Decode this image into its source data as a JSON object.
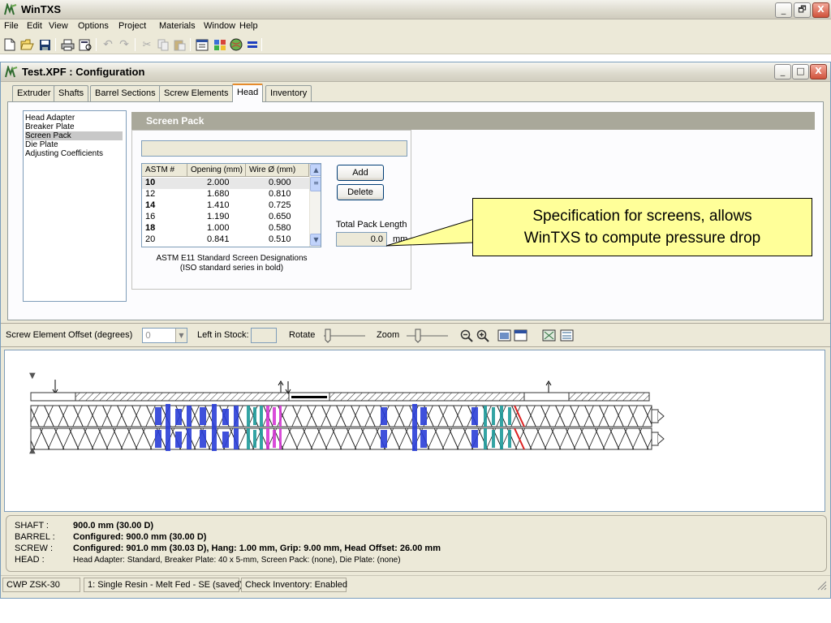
{
  "app": {
    "title": "WinTXS",
    "window_buttons": [
      "_",
      "🗗",
      "X"
    ]
  },
  "menu": [
    "File",
    "Edit",
    "View",
    "Options",
    "Project",
    "Materials",
    "Window",
    "Help"
  ],
  "child": {
    "title": "Test.XPF : Configuration",
    "tabs": [
      "Extruder",
      "Shafts",
      "Barrel Sections",
      "Screw Elements",
      "Head",
      "Inventory"
    ],
    "active_tab": "Head",
    "head_items": [
      "Head Adapter",
      "Breaker Plate",
      "Screen Pack",
      "Die Plate",
      "Adjusting Coefficients"
    ],
    "selected_item": "Screen Pack",
    "section_title": "Screen Pack",
    "screen_name_value": "",
    "table": {
      "headers": [
        "ASTM #",
        "Opening (mm)",
        "Wire Ø (mm)"
      ],
      "rows": [
        {
          "astm": "10",
          "opening": "2.000",
          "wire": "0.900",
          "bold": true
        },
        {
          "astm": "12",
          "opening": "1.680",
          "wire": "0.810",
          "bold": false
        },
        {
          "astm": "14",
          "opening": "1.410",
          "wire": "0.725",
          "bold": true
        },
        {
          "astm": "16",
          "opening": "1.190",
          "wire": "0.650",
          "bold": false
        },
        {
          "astm": "18",
          "opening": "1.000",
          "wire": "0.580",
          "bold": true
        },
        {
          "astm": "20",
          "opening": "0.841",
          "wire": "0.510",
          "bold": false
        }
      ],
      "caption_line1": "ASTM E11 Standard Screen Designations",
      "caption_line2": "(ISO standard series in bold)"
    },
    "add_label": "Add",
    "delete_label": "Delete",
    "total_pack_label": "Total Pack Length",
    "total_pack_value": "0.0",
    "total_pack_unit": "mm",
    "callout_line1": "Specification for screens, allows",
    "callout_line2": "WinTXS to compute pressure drop"
  },
  "screw_bar": {
    "offset_label": "Screw Element Offset (degrees)",
    "offset_value": "0",
    "stock_label": "Left in Stock:",
    "stock_value": "",
    "rotate_label": "Rotate",
    "zoom_label": "Zoom"
  },
  "info": {
    "shaft_key": "SHAFT :",
    "shaft_val": "900.0 mm (30.00 D)",
    "barrel_key": "BARREL :",
    "barrel_val": "Configured: 900.0 mm (30.00 D)",
    "screw_key": "SCREW :",
    "screw_val": "Configured: 901.0 mm (30.03 D), Hang: 1.00 mm, Grip: 9.00 mm, Head Offset: 26.00 mm",
    "head_key": "HEAD :",
    "head_val": "Head Adapter: Standard,  Breaker Plate: 40 x 5-mm,  Screen Pack: (none),  Die Plate: (none)"
  },
  "status": [
    "CWP ZSK-30",
    "1: Single Resin - Melt Fed - SE (saved)",
    "Check Inventory: Enabled"
  ]
}
